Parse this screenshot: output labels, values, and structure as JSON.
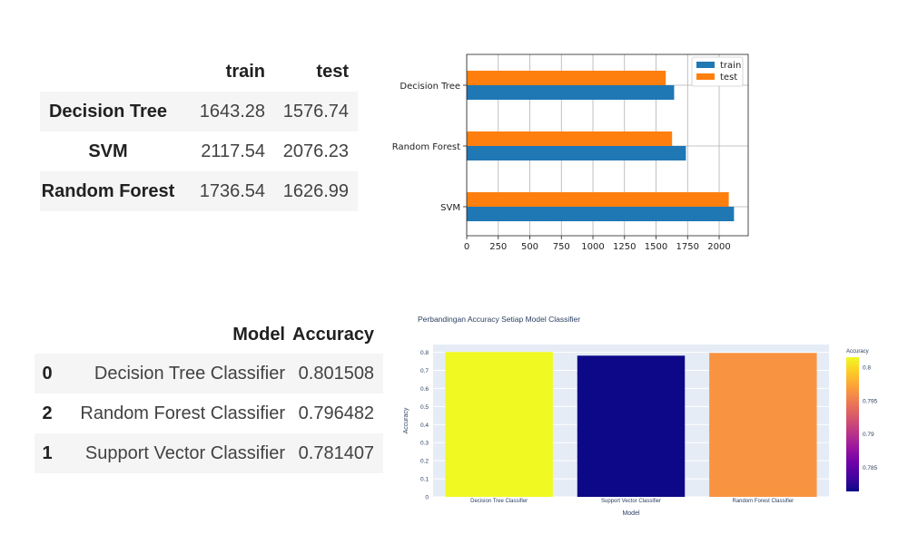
{
  "table1": {
    "columns": [
      "train",
      "test"
    ],
    "rows": [
      {
        "label": "Decision Tree",
        "train": "1643.28",
        "test": "1576.74"
      },
      {
        "label": "SVM",
        "train": "2117.54",
        "test": "2076.23"
      },
      {
        "label": "Random Forest",
        "train": "1736.54",
        "test": "1626.99"
      }
    ]
  },
  "table2": {
    "columns": [
      "Model",
      "Accuracy"
    ],
    "rows": [
      {
        "index": "0",
        "model": "Decision Tree Classifier",
        "accuracy": "0.801508"
      },
      {
        "index": "2",
        "model": "Random Forest Classifier",
        "accuracy": "0.796482"
      },
      {
        "index": "1",
        "model": "Support Vector Classifier",
        "accuracy": "0.781407"
      }
    ]
  },
  "chart_data": [
    {
      "type": "bar",
      "orientation": "horizontal",
      "categories": [
        "Decision Tree",
        "Random Forest",
        "SVM"
      ],
      "series": [
        {
          "name": "train",
          "values": [
            1643.28,
            1736.54,
            2117.54
          ],
          "color": "#1f77b4"
        },
        {
          "name": "test",
          "values": [
            1576.74,
            1626.99,
            2076.23
          ],
          "color": "#ff7f0e"
        }
      ],
      "xticks": [
        "0",
        "250",
        "500",
        "750",
        "1000",
        "1250",
        "1500",
        "1750",
        "2000"
      ],
      "xlim": [
        0,
        2230
      ],
      "grid": true,
      "legend": "top-right"
    },
    {
      "type": "bar",
      "title": "Perbandingan Accuracy Setiap Model Classifier",
      "xlabel": "Model",
      "ylabel": "Accuracy",
      "categories": [
        "Decision Tree Classifier",
        "Support Vector Classifier",
        "Random Forest Classifier"
      ],
      "values": [
        0.801508,
        0.781407,
        0.796482
      ],
      "colors": [
        "#f0f921",
        "#0d0887",
        "#f89441"
      ],
      "yticks": [
        "0",
        "0.1",
        "0.2",
        "0.3",
        "0.4",
        "0.5",
        "0.6",
        "0.7",
        "0.8"
      ],
      "ylim": [
        0,
        0.843
      ],
      "colorbar": {
        "title": "Accuracy",
        "ticks": [
          "0.8",
          "0.795",
          "0.79",
          "0.785"
        ],
        "range": [
          0.781407,
          0.801508
        ],
        "colorscale": [
          "#0d0887",
          "#46039f",
          "#7201a8",
          "#9c179e",
          "#bd3786",
          "#d8576b",
          "#ed7953",
          "#fb9f3a",
          "#fdca26",
          "#f0f921"
        ]
      }
    }
  ]
}
